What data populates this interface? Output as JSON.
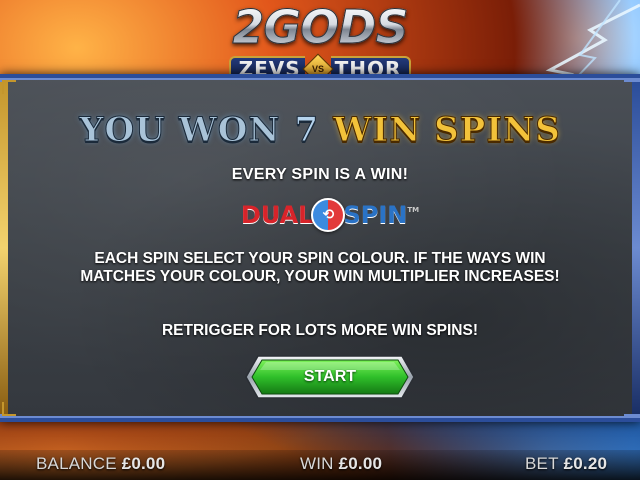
{
  "logo": {
    "title": "2GODS",
    "left_name": "ZEVS",
    "vs": "VS",
    "right_name": "THOR"
  },
  "headline": {
    "prefix": "YOU WON",
    "count": "7",
    "suffix": "WIN SPINS"
  },
  "subtitle": "EVERY SPIN IS A WIN!",
  "feature_logo": {
    "left": "DUAL",
    "right": "SPIN",
    "tm": "TM"
  },
  "description": "EACH SPIN SELECT YOUR SPIN COLOUR. IF THE WAYS WIN MATCHES YOUR COLOUR, YOUR WIN MULTIPLIER INCREASES!",
  "retrigger": "RETRIGGER FOR LOTS MORE WIN SPINS!",
  "start_button": {
    "label": "START"
  },
  "status_bar": {
    "balance": {
      "label": "BALANCE",
      "value": "£0.00"
    },
    "win": {
      "label": "WIN",
      "value": "£0.00"
    },
    "bet": {
      "label": "BET",
      "value": "£0.20"
    }
  },
  "colors": {
    "panel_stone": "#3d4248",
    "gold_accent": "#f2c23a",
    "silver_text": "#a9c3d8",
    "button_green": "#2fbf2a",
    "frame_blue": "#2b4d9a"
  }
}
